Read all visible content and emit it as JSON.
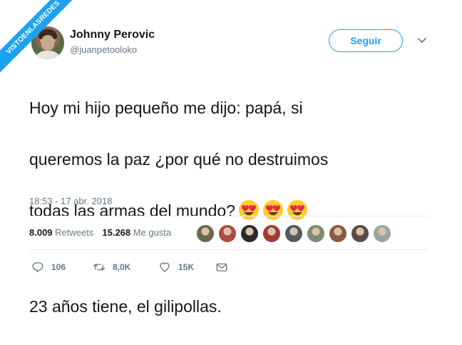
{
  "watermark": "VISTOENLASREDES",
  "author": {
    "name": "Johnny Perovic",
    "handle": "@juanpetooloko",
    "avatar": "avatar-photo"
  },
  "follow_label": "Seguir",
  "tweet": {
    "lines": [
      "Hoy mi hijo pequeño me dijo: papá, si",
      "queremos la paz ¿por qué no destruimos",
      "todas las armas del mundo?"
    ],
    "emoji": [
      "heart-eyes-emoji",
      "heart-eyes-emoji",
      "heart-eyes-emoji"
    ],
    "second_paragraph": "23 años tiene, el gilipollas."
  },
  "timestamp": "18:53 - 17 abr. 2018",
  "stats": {
    "retweets_count": "8.009",
    "retweets_label": "Retweets",
    "likes_count": "15.268",
    "likes_label": "Me gusta"
  },
  "liker_avatars": [
    "#6b6a4e",
    "#b04a3c",
    "#2a2a2a",
    "#a33a3a",
    "#555a60",
    "#7e8a72",
    "#8b5a40",
    "#5c4a4a",
    "#9aa5a0"
  ],
  "actions": {
    "reply_count": "106",
    "retweet_count": "8,0K",
    "like_count": "15K"
  },
  "colors": {
    "accent": "#1da1f2",
    "text": "#14171a",
    "muted": "#657786",
    "divider": "#e6ecf0"
  }
}
